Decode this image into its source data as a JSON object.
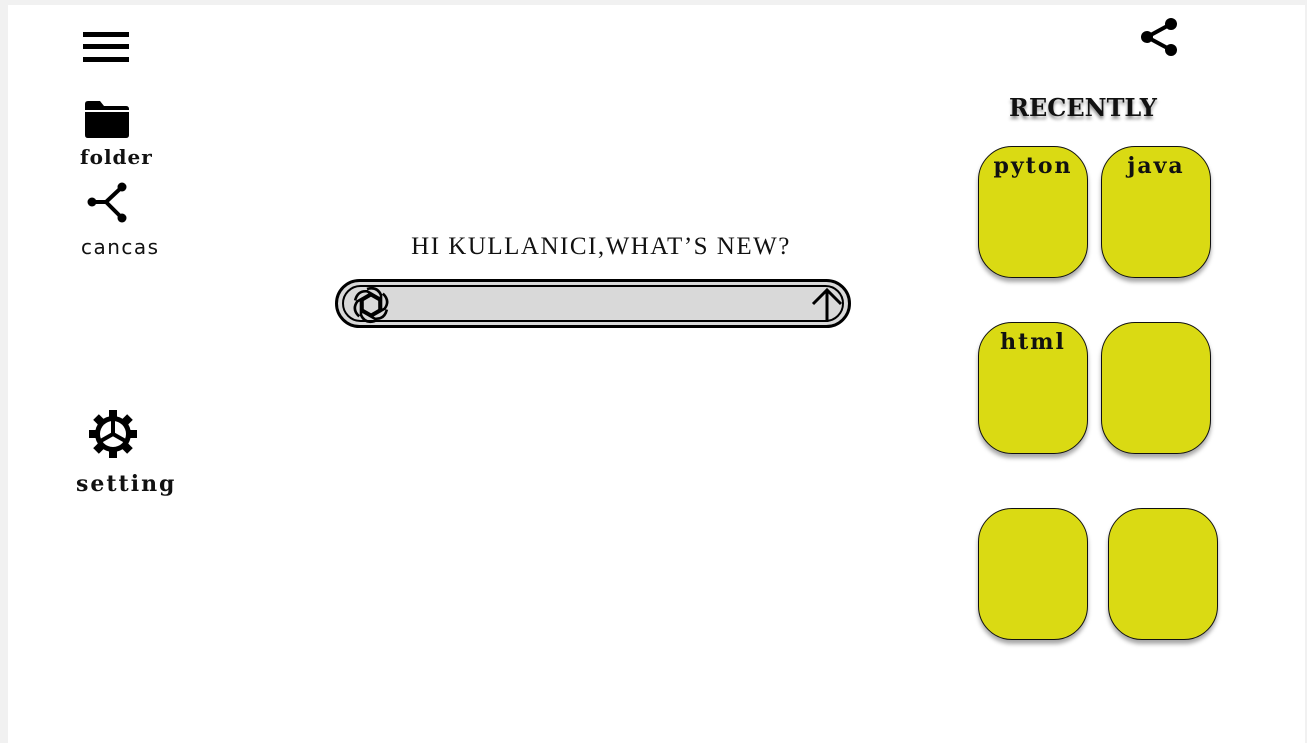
{
  "sidebar": {
    "menu_icon": "hamburger-menu-icon",
    "items": [
      {
        "label": "folder",
        "icon": "folder-icon"
      },
      {
        "label": "cancas",
        "icon": "canvas-branch-icon"
      },
      {
        "label": "setting",
        "icon": "gear-icon"
      }
    ]
  },
  "header": {
    "share_icon": "share-icon"
  },
  "main": {
    "greeting": "HI KULLANICI,WHAT’S NEW?",
    "prompt": {
      "value": "",
      "left_icon": "chatgpt-logo-icon",
      "right_icon": "arrow-up-icon"
    }
  },
  "recently": {
    "title": "RECENTLY",
    "cards": [
      {
        "label": "pyton"
      },
      {
        "label": "java"
      },
      {
        "label": "html"
      },
      {
        "label": ""
      },
      {
        "label": ""
      },
      {
        "label": ""
      }
    ]
  },
  "colors": {
    "card_fill": "#dada13",
    "prompt_fill": "#d9d9d9",
    "ink": "#111111",
    "background": "#ffffff"
  }
}
